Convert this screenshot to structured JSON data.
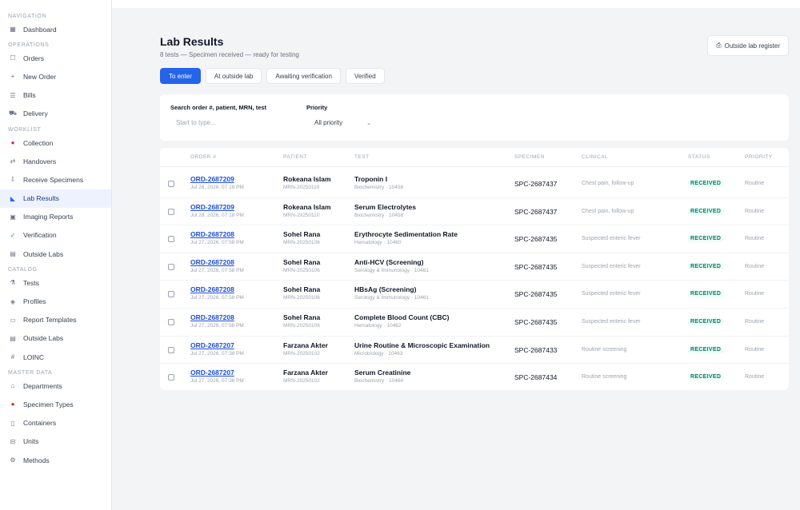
{
  "sidebar": {
    "sections": [
      {
        "label": "NAVIGATION",
        "items": [
          {
            "label": "Dashboard",
            "icon": "grid-icon"
          }
        ]
      },
      {
        "label": "OPERATIONS",
        "items": [
          {
            "label": "Orders",
            "icon": "clipboard-icon"
          },
          {
            "label": "New Order",
            "icon": "plus-icon"
          },
          {
            "label": "Bills",
            "icon": "receipt-icon"
          },
          {
            "label": "Delivery",
            "icon": "truck-icon"
          }
        ]
      },
      {
        "label": "WORKLIST",
        "items": [
          {
            "label": "Collection",
            "icon": "droplet-icon"
          },
          {
            "label": "Handovers",
            "icon": "handover-icon"
          },
          {
            "label": "Receive Specimens",
            "icon": "inbox-icon"
          },
          {
            "label": "Lab Results",
            "icon": "chart-icon",
            "active": true
          },
          {
            "label": "Imaging Reports",
            "icon": "image-icon"
          },
          {
            "label": "Verification",
            "icon": "check-icon"
          },
          {
            "label": "Outside Labs",
            "icon": "building-icon"
          }
        ]
      },
      {
        "label": "CATALOG",
        "items": [
          {
            "label": "Tests",
            "icon": "flask-icon"
          },
          {
            "label": "Profiles",
            "icon": "layers-icon"
          },
          {
            "label": "Report Templates",
            "icon": "template-icon"
          },
          {
            "label": "Outside Labs",
            "icon": "building-icon"
          },
          {
            "label": "LOINC",
            "icon": "code-icon"
          }
        ]
      },
      {
        "label": "MASTER DATA",
        "items": [
          {
            "label": "Departments",
            "icon": "department-icon"
          },
          {
            "label": "Specimen Types",
            "icon": "droplet-icon"
          },
          {
            "label": "Containers",
            "icon": "container-icon"
          },
          {
            "label": "Units",
            "icon": "ruler-icon"
          },
          {
            "label": "Methods",
            "icon": "method-icon"
          }
        ]
      }
    ]
  },
  "page": {
    "title": "Lab Results",
    "subtitle": "8 tests — Specimen received — ready for testing",
    "outside_button": "Outside lab register"
  },
  "tabs": [
    {
      "label": "To enter",
      "active": true
    },
    {
      "label": "At outside lab"
    },
    {
      "label": "Awaiting verification"
    },
    {
      "label": "Verified"
    }
  ],
  "filters": {
    "search_label": "Search order #, patient, MRN, test",
    "search_placeholder": "Start to type...",
    "priority_label": "Priority",
    "priority_value": "All priority"
  },
  "table": {
    "headers": [
      "ORDER #",
      "PATIENT",
      "TEST",
      "SPECIMEN",
      "CLINICAL",
      "STATUS",
      "PRIORITY"
    ],
    "rows": [
      {
        "order": "ORD-2687209",
        "date": "Jul 28, 2026, 07:18 PM",
        "patient": "Rokeana Islam",
        "mrn": "MRN-20250110",
        "test": "Troponin I",
        "dept": "Biochemistry · 10458",
        "specimen": "SPC-2687437",
        "clinical": "Chest pain, follow-up",
        "status": "RECEIVED",
        "priority": "Routine"
      },
      {
        "order": "ORD-2687209",
        "date": "Jul 28, 2026, 07:18 PM",
        "patient": "Rokeana Islam",
        "mrn": "MRN-20250110",
        "test": "Serum Electrolytes",
        "dept": "Biochemistry · 10458",
        "specimen": "SPC-2687437",
        "clinical": "Chest pain, follow-up",
        "status": "RECEIVED",
        "priority": "Routine"
      },
      {
        "order": "ORD-2687208",
        "date": "Jul 27, 2026, 07:58 PM",
        "patient": "Sohel Rana",
        "mrn": "MRN-20250106",
        "test": "Erythrocyte Sedimentation Rate",
        "dept": "Hematology · 10460",
        "specimen": "SPC-2687435",
        "clinical": "Suspected enteric fever",
        "status": "RECEIVED",
        "priority": "Routine"
      },
      {
        "order": "ORD-2687208",
        "date": "Jul 27, 2026, 07:58 PM",
        "patient": "Sohel Rana",
        "mrn": "MRN-20250106",
        "test": "Anti-HCV (Screening)",
        "dept": "Serology & Immunology · 10461",
        "specimen": "SPC-2687435",
        "clinical": "Suspected enteric fever",
        "status": "RECEIVED",
        "priority": "Routine"
      },
      {
        "order": "ORD-2687208",
        "date": "Jul 27, 2026, 07:58 PM",
        "patient": "Sohel Rana",
        "mrn": "MRN-20250106",
        "test": "HBsAg (Screening)",
        "dept": "Serology & Immunology · 10461",
        "specimen": "SPC-2687435",
        "clinical": "Suspected enteric fever",
        "status": "RECEIVED",
        "priority": "Routine"
      },
      {
        "order": "ORD-2687208",
        "date": "Jul 27, 2026, 07:58 PM",
        "patient": "Sohel Rana",
        "mrn": "MRN-20250106",
        "test": "Complete Blood Count (CBC)",
        "dept": "Hematology · 10462",
        "specimen": "SPC-2687435",
        "clinical": "Suspected enteric fever",
        "status": "RECEIVED",
        "priority": "Routine"
      },
      {
        "order": "ORD-2687207",
        "date": "Jul 27, 2026, 07:38 PM",
        "patient": "Farzana Akter",
        "mrn": "MRN-20250102",
        "test": "Urine Routine & Microscopic Examination",
        "dept": "Microbiology · 10463",
        "specimen": "SPC-2687433",
        "clinical": "Routine screening",
        "status": "RECEIVED",
        "priority": "Routine"
      },
      {
        "order": "ORD-2687207",
        "date": "Jul 27, 2026, 07:38 PM",
        "patient": "Farzana Akter",
        "mrn": "MRN-20250102",
        "test": "Serum Creatinine",
        "dept": "Biochemistry · 10464",
        "specimen": "SPC-2687434",
        "clinical": "Routine screening",
        "status": "RECEIVED",
        "priority": "Routine"
      }
    ]
  },
  "colors": {
    "accent": "#2563eb",
    "status": "#0f766e",
    "active_bg": "#eef2ff"
  }
}
